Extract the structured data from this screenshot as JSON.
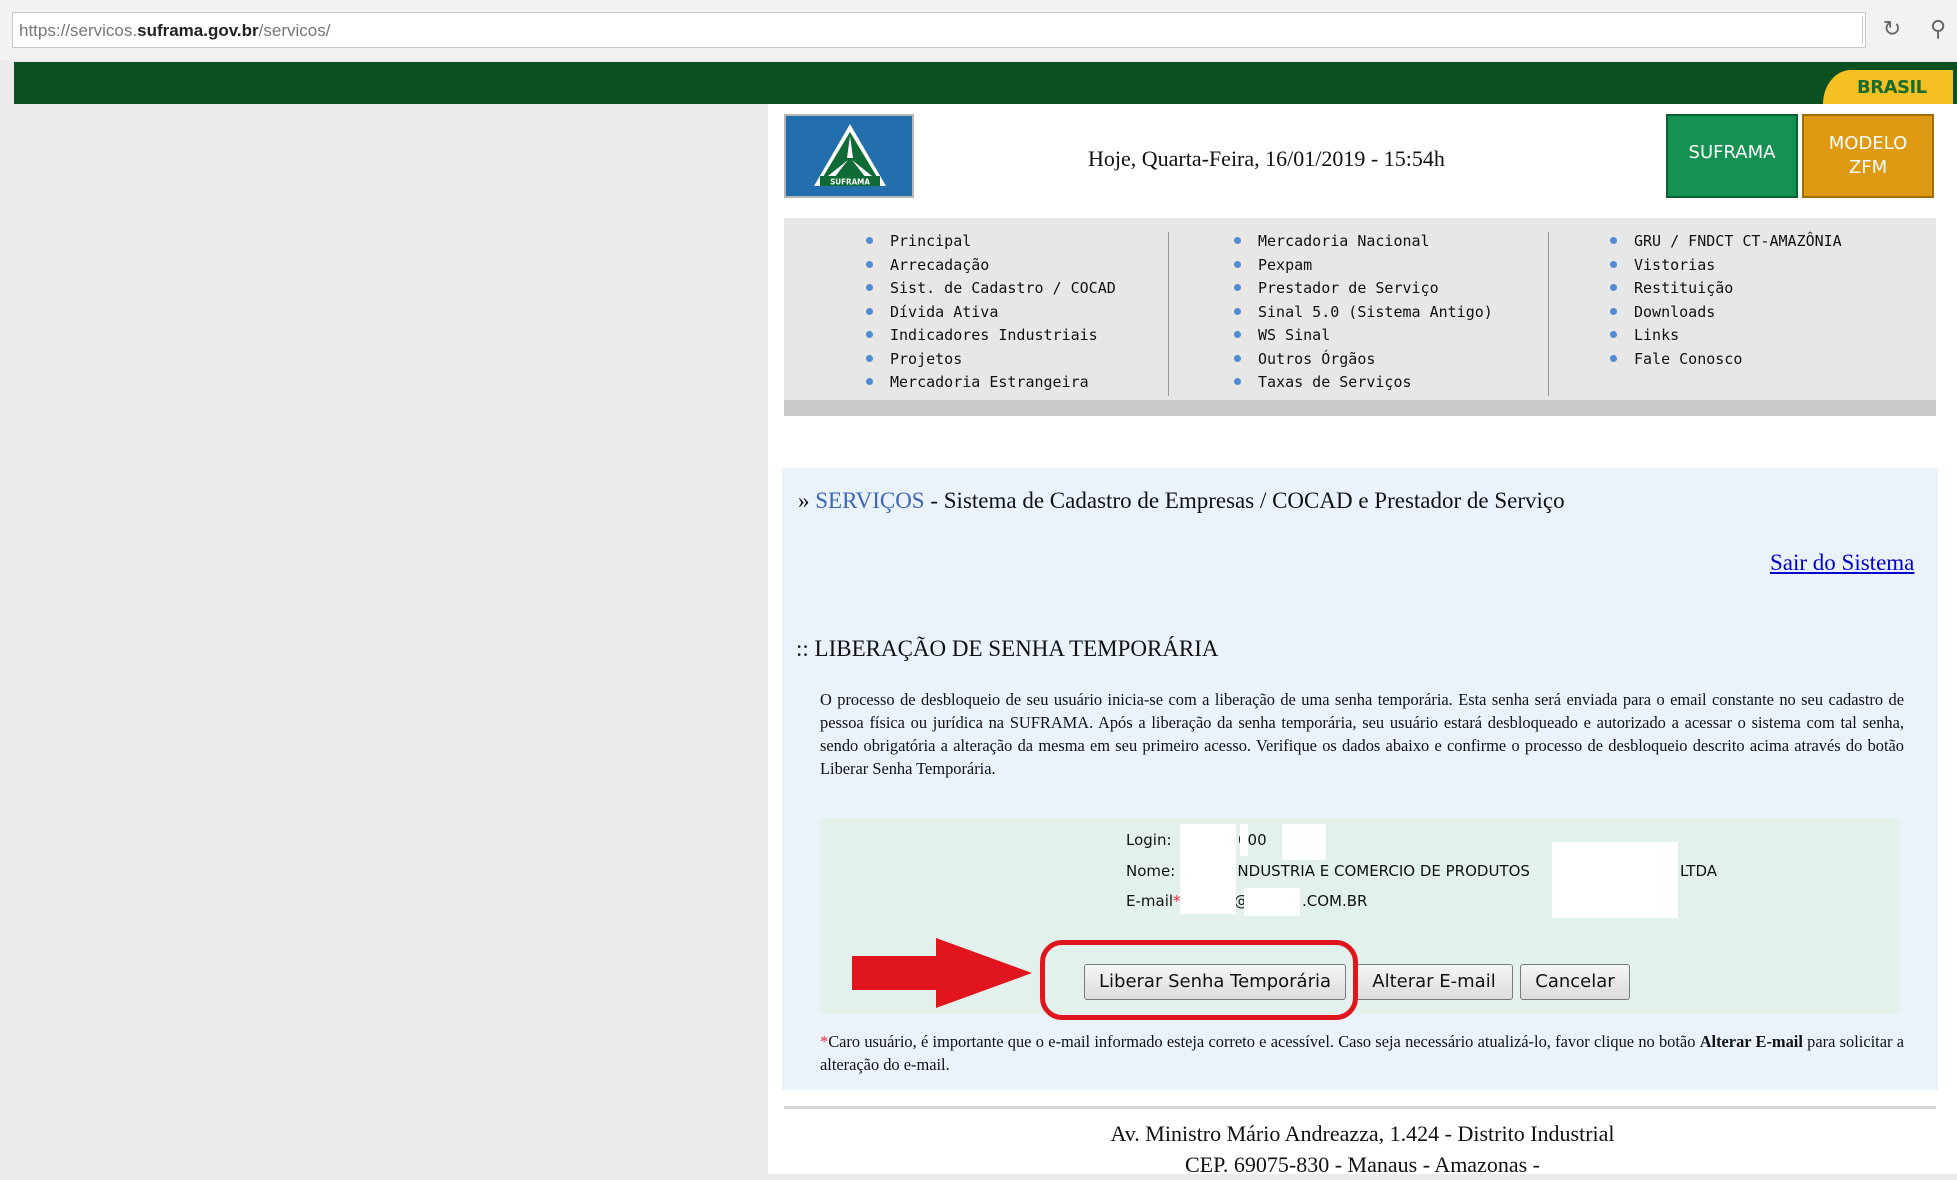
{
  "browser": {
    "url_prefix": "https://servicos.",
    "url_domain": "suframa.gov.br",
    "url_path": "/servicos/",
    "reload_icon": "reload-icon",
    "search_icon": "search-icon"
  },
  "govbar": {
    "badge": "BRASIL"
  },
  "header": {
    "logo_text": "SUFRAMA",
    "datetime": "Hoje, Quarta-Feira, 16/01/2019 - 15:54h",
    "btn_suframa": "SUFRAMA",
    "btn_modelo_line1": "MODELO",
    "btn_modelo_line2": "ZFM"
  },
  "menu": {
    "col1": [
      "Principal",
      "Arrecadação",
      "Sist. de Cadastro / COCAD",
      "Dívida Ativa",
      "Indicadores Industriais",
      "Projetos",
      "Mercadoria Estrangeira"
    ],
    "col2": [
      "Mercadoria Nacional",
      "Pexpam",
      "Prestador de Serviço",
      "Sinal 5.0 (Sistema Antigo)",
      "WS Sinal",
      "Outros Órgãos",
      "Taxas de Serviços"
    ],
    "col3": [
      "GRU / FNDCT CT-AMAZÔNIA",
      "Vistorias",
      "Restituição",
      "Downloads",
      "Links",
      "Fale Conosco"
    ]
  },
  "content": {
    "crumb_prefix": "» ",
    "crumb_link": "SERVIÇOS",
    "crumb_rest": " - Sistema de Cadastro de Empresas / COCAD e Prestador de Serviço",
    "logout": "Sair do Sistema",
    "section_title": ":: LIBERAÇÃO DE SENHA TEMPORÁRIA",
    "description": "O processo de desbloqueio de seu usuário inicia-se com a liberação de uma senha temporária. Esta senha será enviada para o email constante no seu cadastro de pessoa física ou jurídica na SUFRAMA. Após a liberação da senha temporária, seu usuário estará desbloqueado e autorizado a acessar o sistema com tal senha, sendo obrigatória a alteração da mesma em seu primeiro acesso. Verifique os dados abaixo e confirme o processo de desbloqueio descrito acima através do botão Liberar Senha Temporária."
  },
  "form": {
    "login_label": "Login:",
    "login_value": "000",
    "nome_label": "Nome:",
    "nome_value": "INDUSTRIA E COMERCIO DE PRODUTOS",
    "nome_suffix": "LTDA",
    "email_label": "E-mail",
    "email_required_mark": "*",
    "email_colon": ":",
    "email_at": "@",
    "email_domain": ".COM.BR"
  },
  "buttons": {
    "liberar": "Liberar Senha Temporária",
    "alterar": "Alterar E-mail",
    "cancelar": "Cancelar"
  },
  "note": {
    "star": "*",
    "text1": "Caro usuário, é importante que o e-mail informado esteja correto e acessível. Caso seja necessário atualizá-lo, favor clique no botão ",
    "bold": "Alterar E-mail",
    "text2": " para solicitar a alteração do e-mail."
  },
  "footer": {
    "line1": "Av. Ministro Mário Andreazza, 1.424 - Distrito Industrial",
    "line2": "CEP. 69075-830 - Manaus - Amazonas -"
  },
  "colors": {
    "gov_green": "#0b5020",
    "brasil_yellow": "#f5c021",
    "suframa_green": "#159151",
    "modelo_orange": "#dd9a12",
    "annotation_red": "#e0151d",
    "link_blue": "#3a66b8"
  }
}
